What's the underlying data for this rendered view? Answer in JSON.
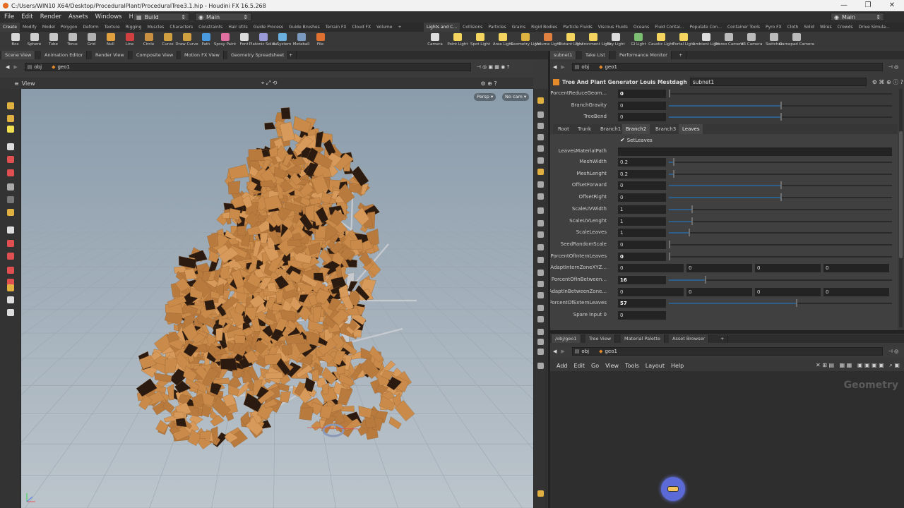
{
  "window": {
    "title": "C:/Users/WIN10 X64/Desktop/ProceduralPlant/ProceduralTree3.1.hip - Houdini FX 16.5.268",
    "min": "—",
    "max": "❐",
    "close": "✕"
  },
  "menubar": {
    "items": [
      "File",
      "Edit",
      "Render",
      "Assets",
      "Windows",
      "Help"
    ],
    "build": "Build",
    "desktop": "Main",
    "desktop_right": "Main"
  },
  "shelf_tabs_left": [
    "Create",
    "Modify",
    "Model",
    "Polygon",
    "Deform",
    "Texture",
    "Rigging",
    "Muscles",
    "Characters",
    "Constraints",
    "Hair Utils",
    "Guide Process",
    "Guide Brushes",
    "Terrain FX",
    "Cloud FX",
    "Volume"
  ],
  "shelf_tabs_right": [
    "Lights and C...",
    "Collisions",
    "Particles",
    "Grains",
    "Rigid Bodies",
    "Particle Fluids",
    "Viscous Fluids",
    "Oceans",
    "Fluid Contai...",
    "Populate Con...",
    "Container Tools",
    "Pyro FX",
    "Cloth",
    "Solid",
    "Wires",
    "Crowds",
    "Drive Simula..."
  ],
  "tools_left": [
    "Box",
    "Sphere",
    "Tube",
    "Torus",
    "Grid",
    "Null",
    "Line",
    "Circle",
    "Curve",
    "Draw Curve",
    "Path",
    "Spray Paint",
    "Font",
    "Platonic Solids",
    "L-System",
    "Metaball",
    "File"
  ],
  "tools_right": [
    "Camera",
    "Point Light",
    "Spot Light",
    "Area Light",
    "Geometry Light",
    "Volume Light",
    "Distant Light",
    "Environment Light",
    "Sky Light",
    "GI Light",
    "Caustic Light",
    "Portal Light",
    "Ambient Light",
    "Stereo Camera",
    "VR Camera",
    "Switcher",
    "Gamepad Camera"
  ],
  "left_panel_tabs": [
    "Scene View",
    "Animation Editor",
    "Render View",
    "Composite View",
    "Motion FX View",
    "Geometry Spreadsheet"
  ],
  "right_panel_tabs": [
    "subnet1",
    "Take List",
    "Performance Monitor"
  ],
  "bottom_panel_tabs": [
    "/obj/geo1",
    "Tree View",
    "Material Palette",
    "Asset Browser"
  ],
  "path": {
    "obj": "obj",
    "geo": "geo1"
  },
  "viewport": {
    "title": "View",
    "persp": "Persp",
    "cam": "No cam"
  },
  "params": {
    "node_type": "Tree And Plant Generator Louis Mestdagh",
    "node_name": "subnet1",
    "top_rows": [
      {
        "label": "PorcentReduceGeom...",
        "value": "0",
        "bold": true,
        "fill": 0.0
      },
      {
        "label": "BranchGravity",
        "value": "0",
        "bold": false,
        "fill": 0.5
      },
      {
        "label": "TreeBend",
        "value": "0",
        "bold": false,
        "fill": 0.5
      }
    ],
    "tabs": [
      "Root",
      "Trunk",
      "Branch1",
      "Branch2",
      "Branch3",
      "Leaves"
    ],
    "setleaves": "SetLeaves",
    "check": "✔",
    "material_label": "LeavesMaterialPath",
    "rows": [
      {
        "label": "MeshWidth",
        "value": "0.2",
        "bold": false,
        "fill": 0.02
      },
      {
        "label": "MeshLenght",
        "value": "0.2",
        "bold": false,
        "fill": 0.02
      },
      {
        "label": "OffsetForward",
        "value": "0",
        "bold": false,
        "fill": 0.5
      },
      {
        "label": "OffsetRight",
        "value": "0",
        "bold": false,
        "fill": 0.5
      },
      {
        "label": "ScaleUVWidth",
        "value": "1",
        "bold": false,
        "fill": 0.1
      },
      {
        "label": "ScaleUVLenght",
        "value": "1",
        "bold": false,
        "fill": 0.1
      },
      {
        "label": "ScaleLeaves",
        "value": "1",
        "bold": false,
        "fill": 0.09
      },
      {
        "label": "SeedRandomScale",
        "value": "0",
        "bold": false,
        "fill": 0.0
      },
      {
        "label": "PorcentOfInternLeaves",
        "value": "0",
        "bold": true,
        "fill": 0.0
      },
      {
        "label": "AdaptInternZoneXYZ...",
        "vec": [
          "0",
          "0",
          "0",
          "0"
        ]
      },
      {
        "label": "PorcentOfInBetween...",
        "value": "16",
        "bold": true,
        "fill": 0.16
      },
      {
        "label": "AdaptInBetweenZone...",
        "vec": [
          "0",
          "0",
          "0",
          "0"
        ]
      },
      {
        "label": "PorcentOfExternLeaves",
        "value": "57",
        "bold": true,
        "fill": 0.57
      },
      {
        "label": "Spare Input 0",
        "value": "0",
        "bold": false,
        "fill": null
      }
    ]
  },
  "netmenu": [
    "Add",
    "Edit",
    "Go",
    "View",
    "Tools",
    "Layout",
    "Help"
  ],
  "net_label": "Geometry"
}
